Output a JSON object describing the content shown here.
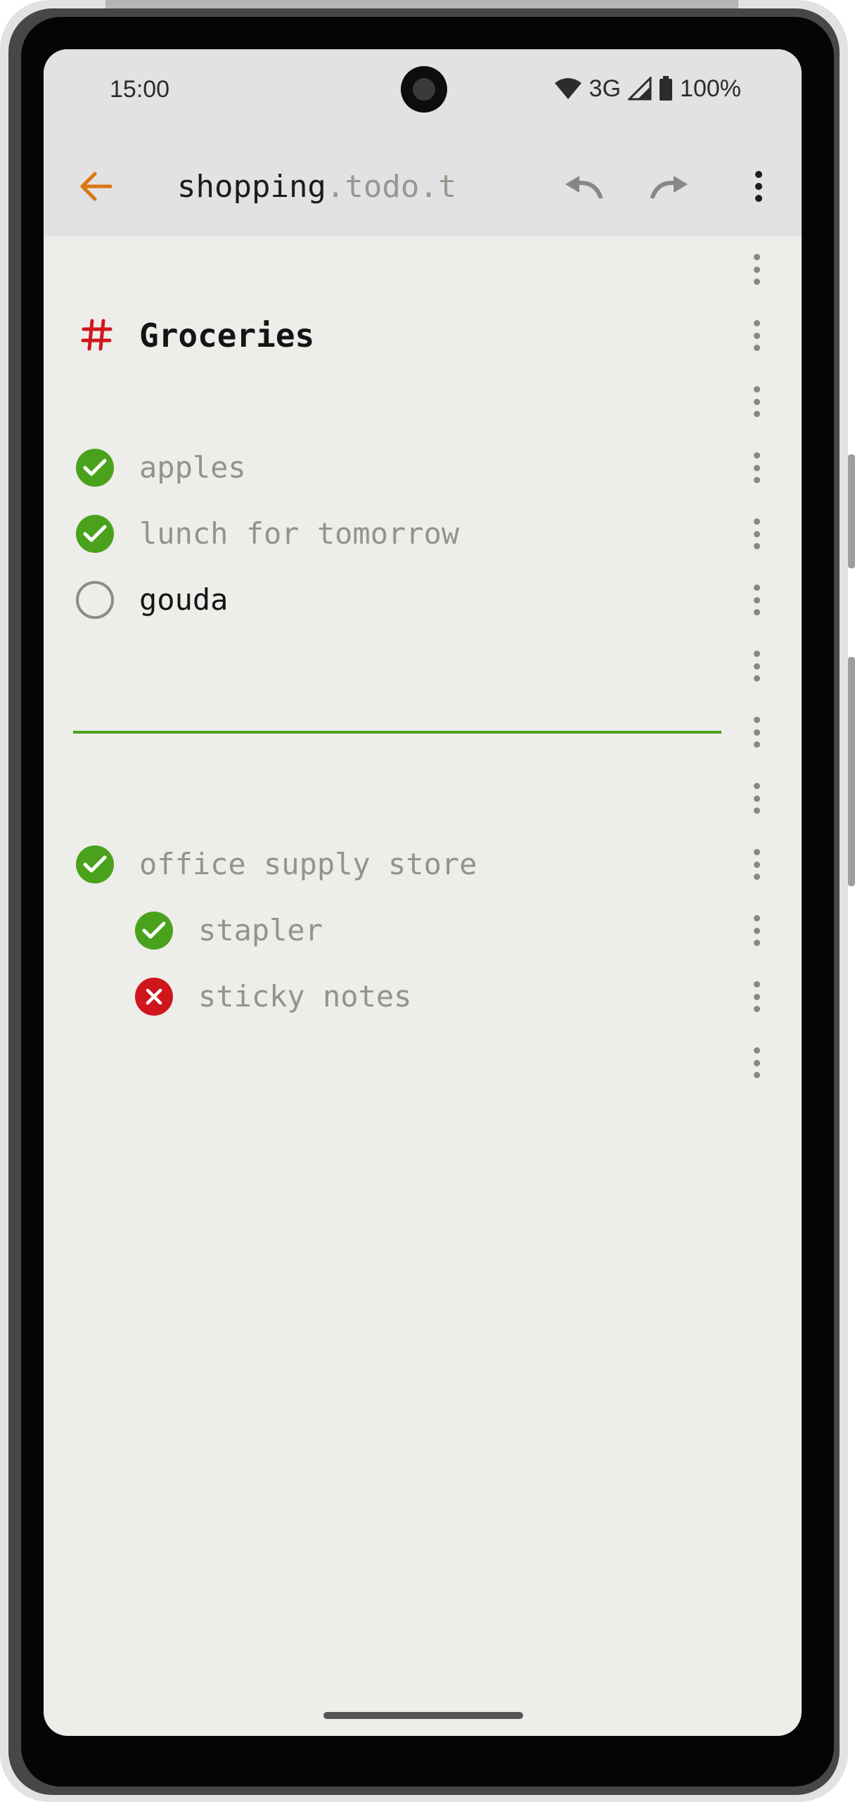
{
  "status_bar": {
    "time": "15:00",
    "network": "3G",
    "battery": "100%",
    "icons": [
      "wifi-icon",
      "signal-icon",
      "battery-icon"
    ]
  },
  "app_bar": {
    "file_base": "shopping",
    "file_ext": ".todo.t",
    "actions": [
      "back-arrow-icon",
      "undo-icon",
      "redo-icon",
      "more-vert-icon"
    ]
  },
  "colors": {
    "accent_back": "#d9770f",
    "done": "#4aa21c",
    "cancelled": "#d0161d",
    "heading_mark": "#d0161d",
    "background": "#ededea",
    "appbar": "#e2e1e4"
  },
  "document": {
    "heading": "Groceries",
    "groups": [
      {
        "items": [
          {
            "text": "apples",
            "state": "done"
          },
          {
            "text": "lunch for tomorrow",
            "state": "done"
          },
          {
            "text": "gouda",
            "state": "open"
          }
        ]
      },
      {
        "items": [
          {
            "text": "office supply store",
            "state": "done"
          },
          {
            "text": "stapler",
            "state": "done",
            "indent": 1
          },
          {
            "text": "sticky notes",
            "state": "cancelled",
            "indent": 1
          }
        ]
      }
    ]
  }
}
